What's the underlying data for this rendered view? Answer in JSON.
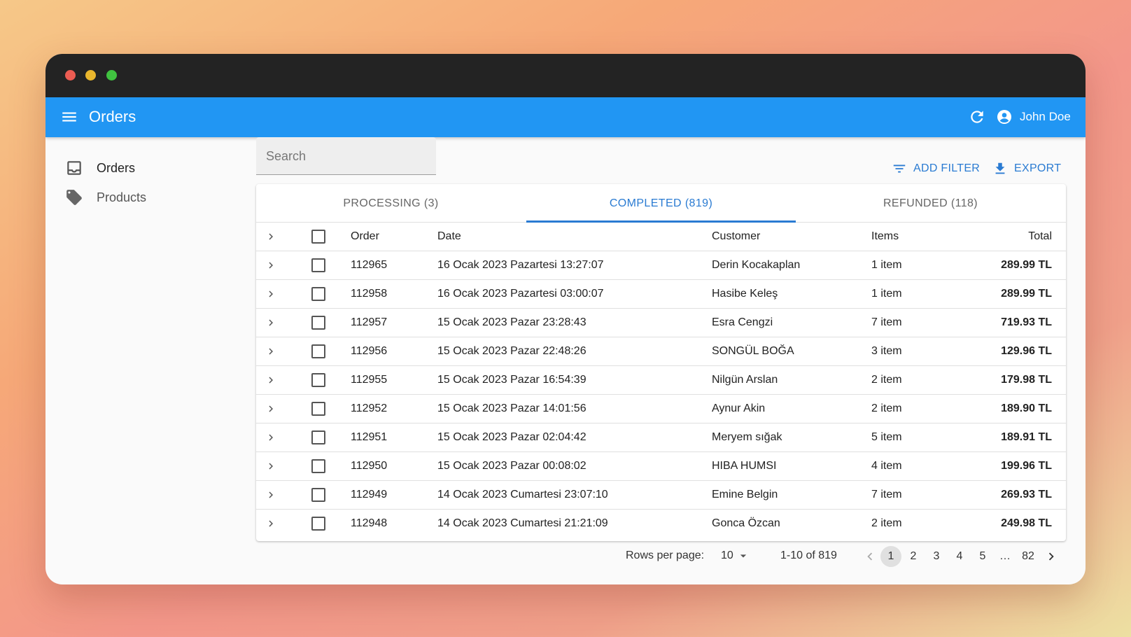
{
  "app": {
    "title": "Orders",
    "user": "John Doe"
  },
  "sidebar": {
    "items": [
      {
        "label": "Orders",
        "icon": "inbox-icon"
      },
      {
        "label": "Products",
        "icon": "tag-icon"
      }
    ]
  },
  "search": {
    "placeholder": "Search",
    "value": ""
  },
  "toolbar": {
    "add_filter": "ADD FILTER",
    "export": "EXPORT"
  },
  "tabs": [
    {
      "label": "PROCESSING (3)",
      "active": false
    },
    {
      "label": "COMPLETED (819)",
      "active": true
    },
    {
      "label": "REFUNDED (118)",
      "active": false
    }
  ],
  "table": {
    "headers": {
      "order": "Order",
      "date": "Date",
      "customer": "Customer",
      "items": "Items",
      "total": "Total"
    },
    "rows": [
      {
        "order": "112965",
        "date": "16 Ocak 2023 Pazartesi 13:27:07",
        "customer": "Derin Kocakaplan",
        "items": "1 item",
        "total": "289.99 TL"
      },
      {
        "order": "112958",
        "date": "16 Ocak 2023 Pazartesi 03:00:07",
        "customer": "Hasibe Keleş",
        "items": "1 item",
        "total": "289.99 TL"
      },
      {
        "order": "112957",
        "date": "15 Ocak 2023 Pazar 23:28:43",
        "customer": "Esra Cengzi",
        "items": "7 item",
        "total": "719.93 TL"
      },
      {
        "order": "112956",
        "date": "15 Ocak 2023 Pazar 22:48:26",
        "customer": "SONGÜL BOĞA",
        "items": "3 item",
        "total": "129.96 TL"
      },
      {
        "order": "112955",
        "date": "15 Ocak 2023 Pazar 16:54:39",
        "customer": "Nilgün Arslan",
        "items": "2 item",
        "total": "179.98 TL"
      },
      {
        "order": "112952",
        "date": "15 Ocak 2023 Pazar 14:01:56",
        "customer": "Aynur Akin",
        "items": "2 item",
        "total": "189.90 TL"
      },
      {
        "order": "112951",
        "date": "15 Ocak 2023 Pazar 02:04:42",
        "customer": "Meryem sığak",
        "items": "5 item",
        "total": "189.91 TL"
      },
      {
        "order": "112950",
        "date": "15 Ocak 2023 Pazar 00:08:02",
        "customer": "HIBA HUMSI",
        "items": "4 item",
        "total": "199.96 TL"
      },
      {
        "order": "112949",
        "date": "14 Ocak 2023 Cumartesi 23:07:10",
        "customer": "Emine Belgin",
        "items": "7 item",
        "total": "269.93 TL"
      },
      {
        "order": "112948",
        "date": "14 Ocak 2023 Cumartesi 21:21:09",
        "customer": "Gonca Özcan",
        "items": "2 item",
        "total": "249.98 TL"
      }
    ]
  },
  "pagination": {
    "rows_per_page_label": "Rows per page:",
    "rows_per_page": "10",
    "range": "1-10 of 819",
    "pages": [
      "1",
      "2",
      "3",
      "4",
      "5",
      "…",
      "82"
    ],
    "current_page": "1"
  },
  "colors": {
    "appbar": "#2196f3",
    "accent": "#2a7bd2",
    "titlebar": "#232323"
  }
}
